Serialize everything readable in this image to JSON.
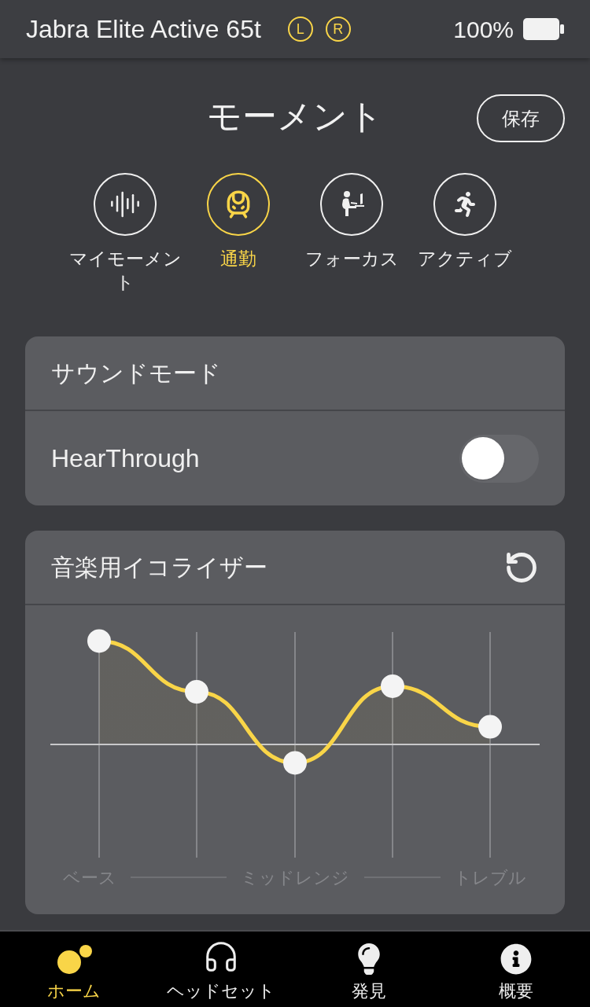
{
  "status_bar": {
    "device": "Jabra Elite Active 65t",
    "earbuds": [
      "L",
      "R"
    ],
    "battery": "100%"
  },
  "header": {
    "title": "モーメント",
    "save_button": "保存"
  },
  "moments": [
    {
      "label": "マイモーメント",
      "kind": "waveform",
      "selected": false
    },
    {
      "label": "通勤",
      "kind": "train",
      "selected": true
    },
    {
      "label": "フォーカス",
      "kind": "desk",
      "selected": false
    },
    {
      "label": "アクティブ",
      "kind": "runner",
      "selected": false
    }
  ],
  "sound_mode": {
    "title": "サウンドモード",
    "hearthrough": {
      "label": "HearThrough",
      "on": false
    }
  },
  "equalizer": {
    "title": "音楽用イコライザー",
    "axis_labels": [
      "ベース",
      "ミッドレンジ",
      "トレブル"
    ]
  },
  "tab_bar": [
    {
      "label": "ホーム",
      "kind": "home",
      "selected": true
    },
    {
      "label": "ヘッドセット",
      "kind": "headset",
      "selected": false
    },
    {
      "label": "発見",
      "kind": "discover",
      "selected": false
    },
    {
      "label": "概要",
      "kind": "about",
      "selected": false
    }
  ]
}
